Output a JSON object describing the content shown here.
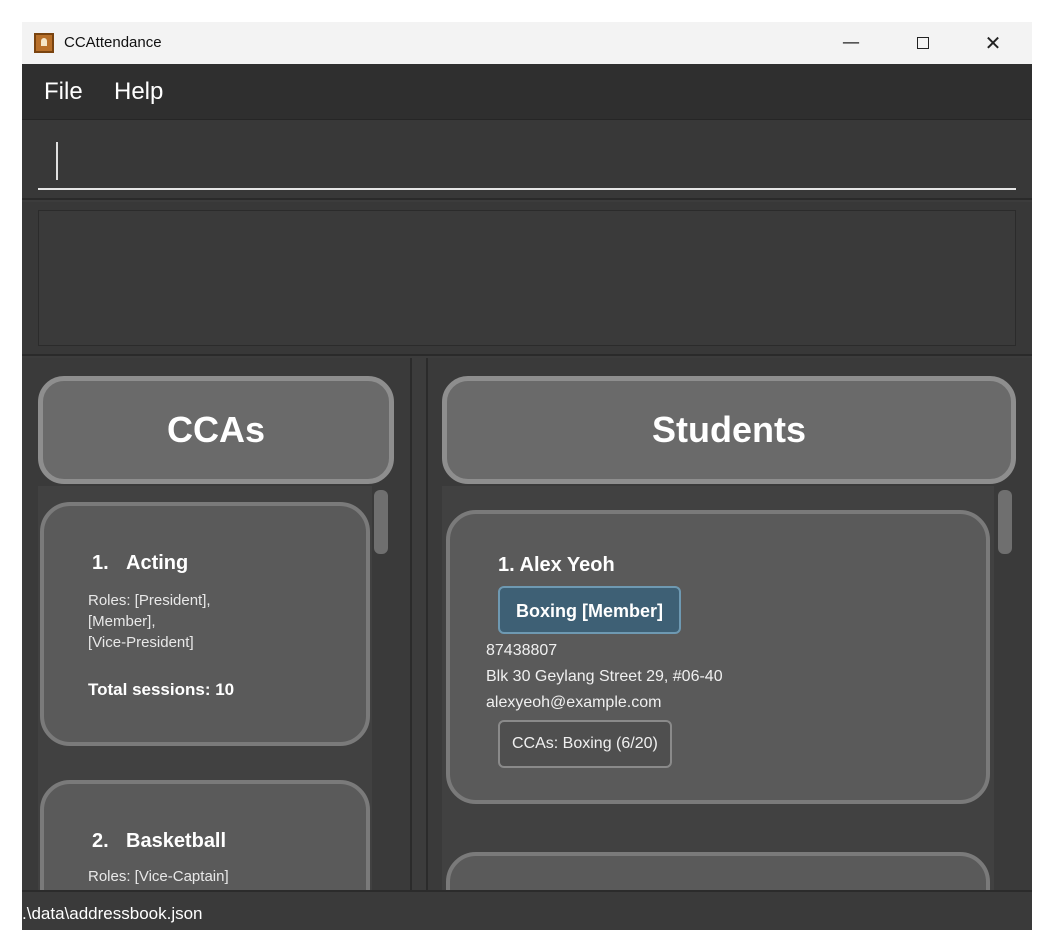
{
  "window": {
    "title": "CCAttendance",
    "minimize_glyph": "—",
    "close_glyph": "✕",
    "app_icon": "contact-card-icon"
  },
  "menu": {
    "items": [
      "File",
      "Help"
    ]
  },
  "command": {
    "value": "",
    "placeholder": ""
  },
  "result": {
    "text": ""
  },
  "ccas": {
    "header": "CCAs",
    "items": [
      {
        "index": "1.",
        "name": "Acting",
        "roles": "Roles: [President], [Member], [Vice-President]",
        "roles_lines": [
          "Roles: [President],",
          "[Member],",
          "[Vice-President]"
        ],
        "sessions": "Total sessions: 10"
      },
      {
        "index": "2.",
        "name": "Basketball",
        "roles_partial": "Roles: [Vice-Captain]"
      }
    ]
  },
  "students": {
    "header": "Students",
    "items": [
      {
        "name": "1. Alex Yeoh",
        "tag": "Boxing [Member]",
        "phone": "87438807",
        "address": "Blk 30 Geylang Street 29, #06-40",
        "email": "alexyeoh@example.com",
        "ccas": "CCAs: Boxing (6/20)"
      }
    ]
  },
  "status": {
    "path": ".\\data\\addressbook.json"
  },
  "colors": {
    "background": "#3c3c3c",
    "card": "#5a5a5a",
    "header_card": "#6a6a6a",
    "tag": "#3e6075"
  }
}
